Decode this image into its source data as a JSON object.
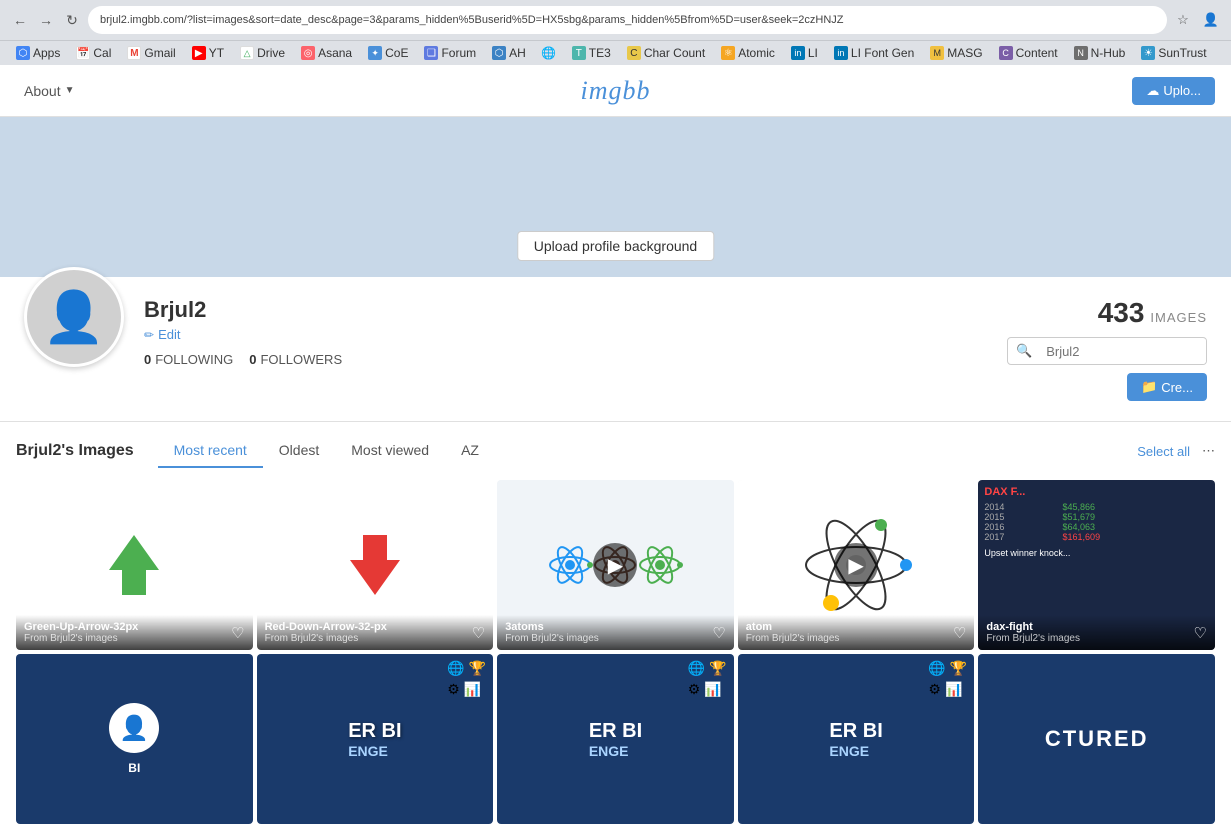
{
  "browser": {
    "url": "brjul2.imgbb.com/?list=images&sort=date_desc&page=3&params_hidden%5Buserid%5D=HX5sbg&params_hidden%5Bfrom%5D=user&seek=2czHNJZ",
    "back_label": "←",
    "forward_label": "→",
    "refresh_label": "↻"
  },
  "bookmarks": [
    {
      "id": "apps",
      "label": "Apps",
      "icon": "⬡",
      "color": "#4285f4"
    },
    {
      "id": "cal",
      "label": "Cal",
      "icon": "📅",
      "color": "#fff"
    },
    {
      "id": "gmail",
      "label": "Gmail",
      "icon": "M",
      "color": "#ea4335"
    },
    {
      "id": "yt",
      "label": "YT",
      "icon": "▶",
      "color": "#ff0000"
    },
    {
      "id": "drive",
      "label": "Drive",
      "icon": "△",
      "color": "#34a853"
    },
    {
      "id": "asana",
      "label": "Asana",
      "icon": "◎",
      "color": "#fc636b"
    },
    {
      "id": "coe",
      "label": "CoE",
      "icon": "✦",
      "color": "#4a90d9"
    },
    {
      "id": "forum",
      "label": "Forum",
      "icon": "❑",
      "color": "#5e7ae0"
    },
    {
      "id": "ah",
      "label": "AH",
      "icon": "⬡",
      "color": "#3b82c4"
    },
    {
      "id": "globe",
      "label": "",
      "icon": "🌐",
      "color": "#666"
    },
    {
      "id": "te3",
      "label": "TE3",
      "icon": "T",
      "color": "#4db6ac"
    },
    {
      "id": "charcount",
      "label": "Char Count",
      "icon": "C",
      "color": "#e8c84a"
    },
    {
      "id": "atomic",
      "label": "Atomic",
      "icon": "⚛",
      "color": "#f5a623"
    },
    {
      "id": "li",
      "label": "LI",
      "icon": "in",
      "color": "#0077b5"
    },
    {
      "id": "lifont",
      "label": "LI Font Gen",
      "icon": "in",
      "color": "#0077b5"
    },
    {
      "id": "masg",
      "label": "MASG",
      "icon": "M",
      "color": "#f0c040"
    },
    {
      "id": "content",
      "label": "Content",
      "icon": "C",
      "color": "#7b5ea7"
    },
    {
      "id": "nhub",
      "label": "N-Hub",
      "icon": "N",
      "color": "#6e6e6e"
    },
    {
      "id": "sun",
      "label": "SunTrust",
      "icon": "☀",
      "color": "#3399cc"
    }
  ],
  "nav": {
    "about_label": "About",
    "logo": "imgbb",
    "upload_label": "Uplo..."
  },
  "profile": {
    "upload_bg_label": "Upload profile background",
    "name": "Brjul2",
    "edit_label": "Edit",
    "following_count": "0",
    "following_label": "FOLLOWING",
    "followers_count": "0",
    "followers_label": "FOLLOWERS",
    "images_count": "433",
    "images_label": "IMAGES",
    "search_placeholder": "Brjul2",
    "create_label": "Cre..."
  },
  "images_section": {
    "title": "Brjul2's Images",
    "tabs": [
      {
        "id": "most-recent",
        "label": "Most recent",
        "active": true
      },
      {
        "id": "oldest",
        "label": "Oldest",
        "active": false
      },
      {
        "id": "most-viewed",
        "label": "Most viewed",
        "active": false
      },
      {
        "id": "az",
        "label": "AZ",
        "active": false
      }
    ],
    "select_all_label": "Select all"
  },
  "image_cards_row1": [
    {
      "id": "green-up-arrow",
      "title": "Green-Up-Arrow-32px",
      "sub": "From Brjul2's images",
      "type": "arrow-green",
      "bg": "white"
    },
    {
      "id": "red-down-arrow",
      "title": "Red-Down-Arrow-32-px",
      "sub": "From Brjul2's images",
      "type": "arrow-red",
      "bg": "white"
    },
    {
      "id": "3atoms",
      "title": "3atoms",
      "sub": "From Brjul2's images",
      "type": "atoms-video",
      "bg": "#f0f4f8"
    },
    {
      "id": "atom",
      "title": "atom",
      "sub": "From Brjul2's images",
      "type": "atom-single",
      "bg": "white"
    },
    {
      "id": "dax-fight",
      "title": "dax-fight",
      "sub": "From Brjul2's images",
      "type": "dax",
      "bg": "#1a2744"
    }
  ],
  "image_cards_row2": [
    {
      "id": "bi-1",
      "title": "",
      "sub": "",
      "type": "bi-dark",
      "bg": "#1a3a6b"
    },
    {
      "id": "bi-er-1",
      "title": "",
      "sub": "",
      "type": "er-bi",
      "bg": "#1a3a6b"
    },
    {
      "id": "bi-er-2",
      "title": "",
      "sub": "",
      "type": "er-bi2",
      "bg": "#1a3a6b"
    },
    {
      "id": "bi-er-3",
      "title": "",
      "sub": "",
      "type": "er-bi3",
      "bg": "#1a3a6b"
    },
    {
      "id": "ctured",
      "title": "",
      "sub": "",
      "type": "ctured",
      "bg": "#1a3a6b"
    }
  ],
  "colors": {
    "accent": "#4a90d9",
    "text_dark": "#333333",
    "text_mid": "#555555",
    "green": "#4CAF50",
    "red": "#e53935"
  }
}
